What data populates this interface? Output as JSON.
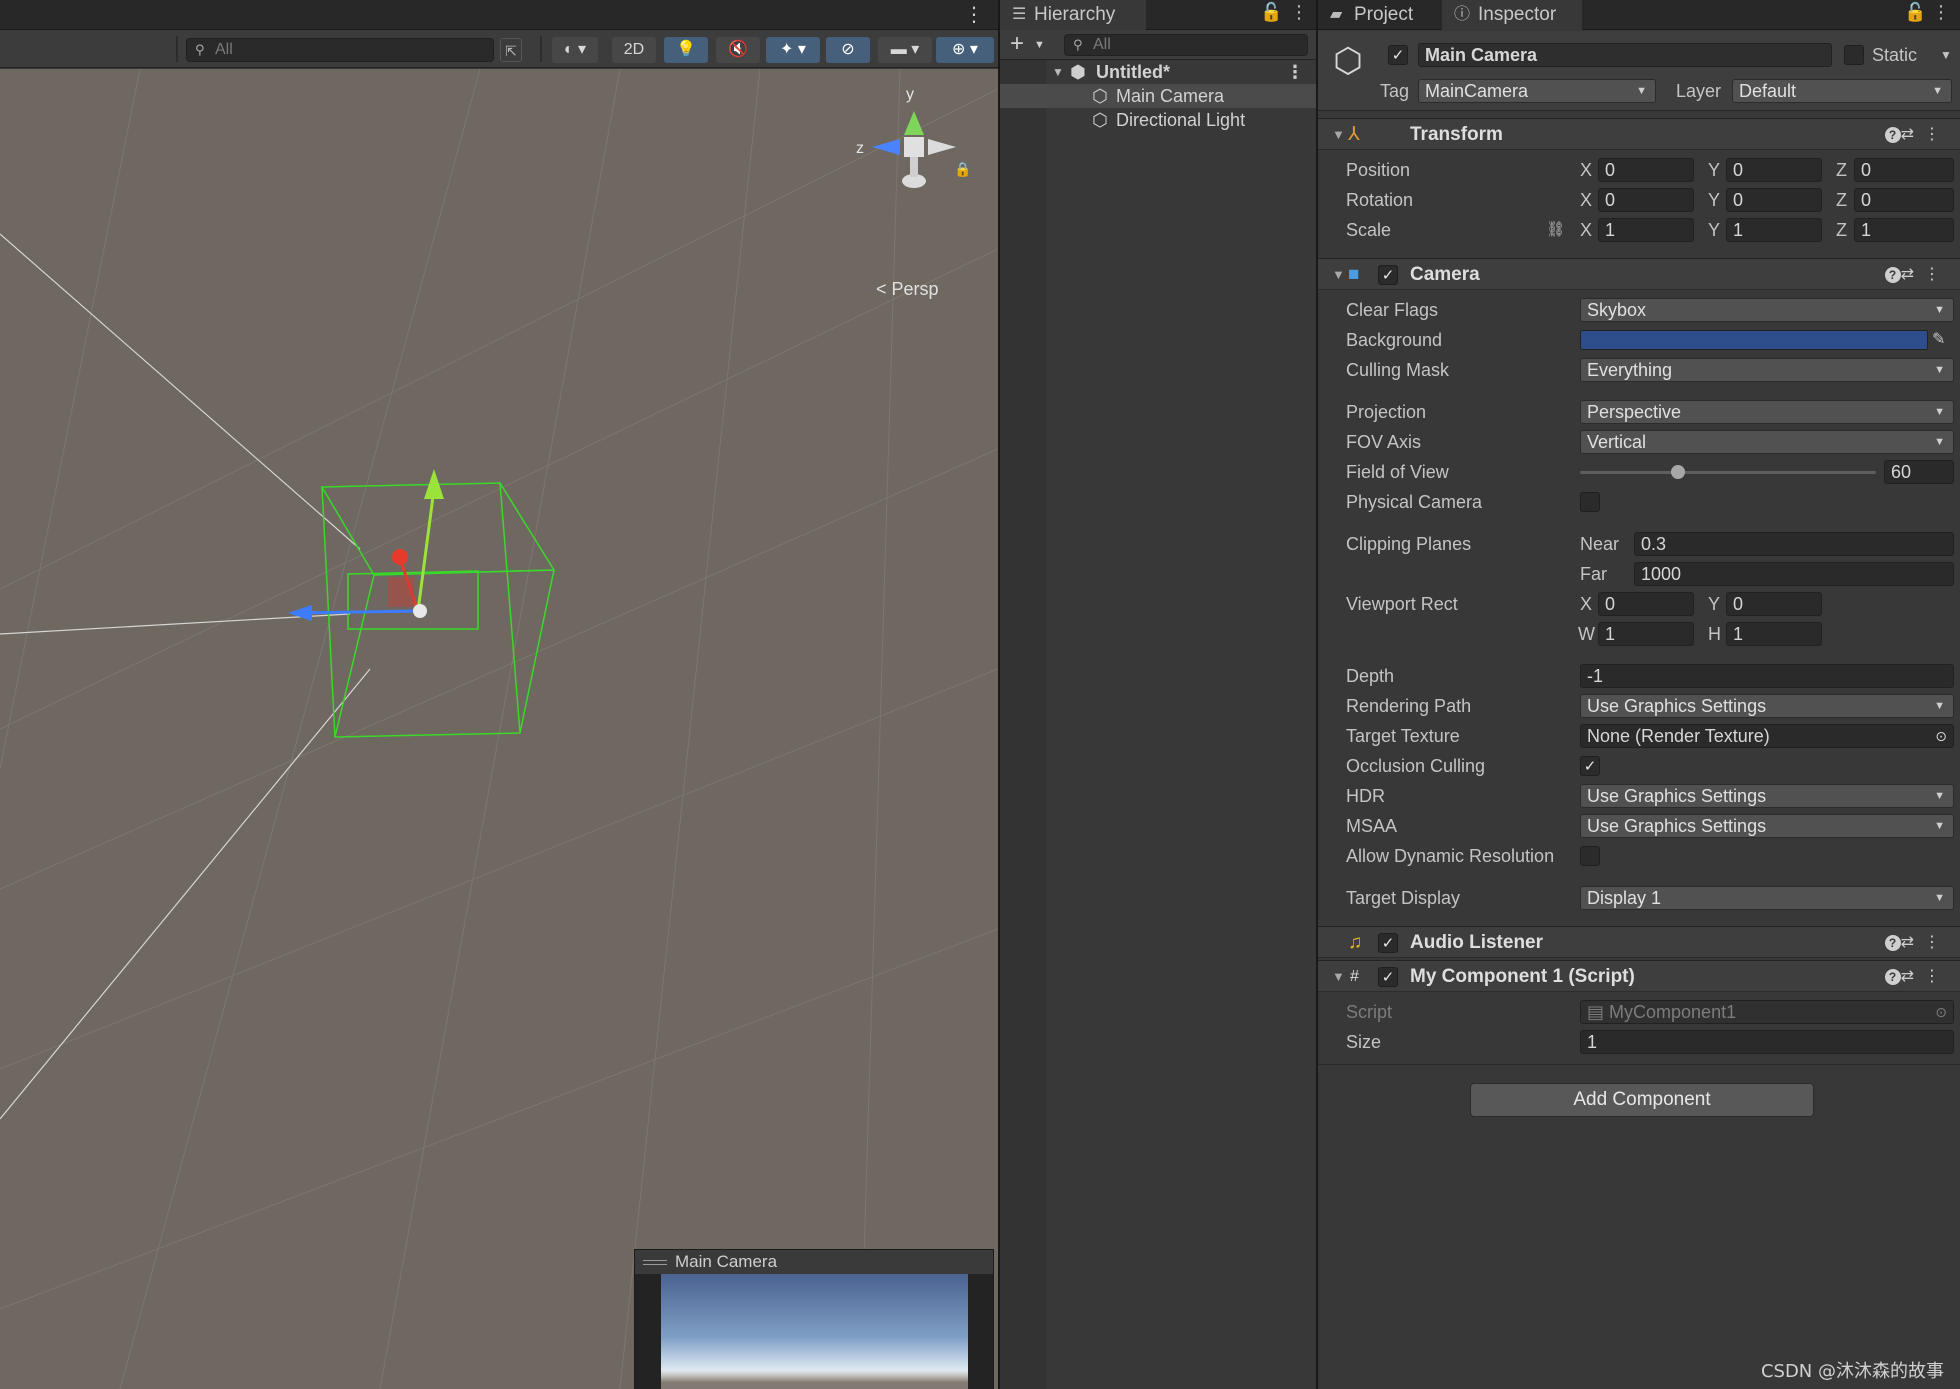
{
  "scene": {
    "search_placeholder": "All",
    "toolbar": {
      "mode_2d": "2D"
    },
    "gizmo": {
      "y_label": "y",
      "z_label": "z",
      "persp_label": "Persp"
    },
    "camera_preview_title": "Main Camera"
  },
  "hierarchy": {
    "tab_label": "Hierarchy",
    "search_placeholder": "All",
    "scene_name": "Untitled*",
    "items": [
      {
        "label": "Main Camera"
      },
      {
        "label": "Directional Light"
      }
    ]
  },
  "tabs": {
    "project": "Project",
    "inspector": "Inspector"
  },
  "inspector": {
    "object_name": "Main Camera",
    "static_label": "Static",
    "tag_label": "Tag",
    "tag_value": "MainCamera",
    "layer_label": "Layer",
    "layer_value": "Default",
    "transform": {
      "title": "Transform",
      "position_label": "Position",
      "rotation_label": "Rotation",
      "scale_label": "Scale",
      "x": "X",
      "y": "Y",
      "z": "Z",
      "position": [
        "0",
        "0",
        "0"
      ],
      "rotation": [
        "0",
        "0",
        "0"
      ],
      "scale": [
        "1",
        "1",
        "1"
      ]
    },
    "camera": {
      "title": "Camera",
      "clear_flags_label": "Clear Flags",
      "clear_flags": "Skybox",
      "background_label": "Background",
      "background_color": "#2d4e8a",
      "culling_mask_label": "Culling Mask",
      "culling_mask": "Everything",
      "projection_label": "Projection",
      "projection": "Perspective",
      "fov_axis_label": "FOV Axis",
      "fov_axis": "Vertical",
      "fov_label": "Field of View",
      "fov": "60",
      "fov_slider_fraction": 0.33,
      "physical_camera_label": "Physical Camera",
      "clipping_planes_label": "Clipping Planes",
      "near_label": "Near",
      "near": "0.3",
      "far_label": "Far",
      "far": "1000",
      "viewport_rect_label": "Viewport Rect",
      "x_label": "X",
      "y_label": "Y",
      "w_label": "W",
      "h_label": "H",
      "vx": "0",
      "vy": "0",
      "vw": "1",
      "vh": "1",
      "depth_label": "Depth",
      "depth": "-1",
      "rendering_path_label": "Rendering Path",
      "rendering_path": "Use Graphics Settings",
      "target_texture_label": "Target Texture",
      "target_texture": "None (Render Texture)",
      "occlusion_culling_label": "Occlusion Culling",
      "hdr_label": "HDR",
      "hdr": "Use Graphics Settings",
      "msaa_label": "MSAA",
      "msaa": "Use Graphics Settings",
      "dynamic_res_label": "Allow Dynamic Resolution",
      "target_display_label": "Target Display",
      "target_display": "Display 1"
    },
    "audio_listener": {
      "title": "Audio Listener"
    },
    "my_component": {
      "title": "My Component 1 (Script)",
      "script_label": "Script",
      "script_value": "MyComponent1",
      "size_label": "Size",
      "size": "1"
    },
    "add_component": "Add Component"
  },
  "watermark": "CSDN @沐沐森的故事",
  "colors": {
    "accent_blue": "#46607c",
    "selection": "#4b4b4b",
    "gizmo_green": "#39d82a"
  }
}
